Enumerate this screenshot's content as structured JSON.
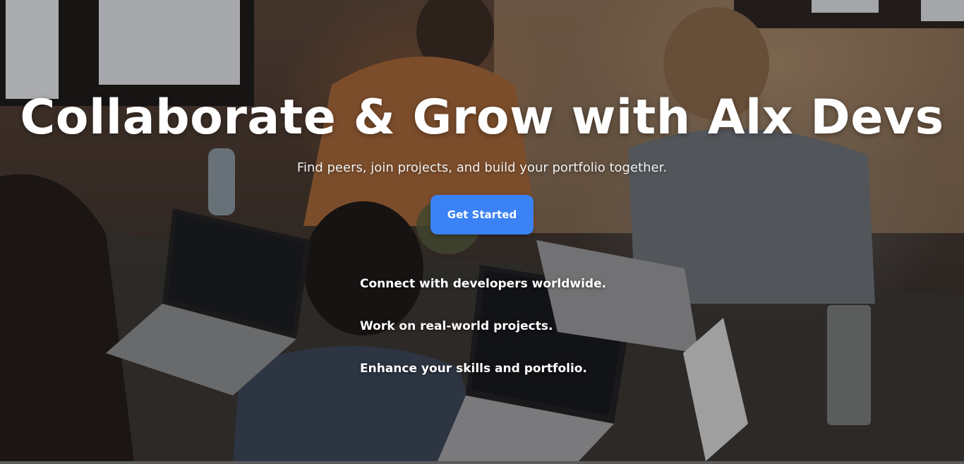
{
  "hero": {
    "background_image": "team-of-developers-working-on-laptops",
    "title": "Collaborate & Grow with Alx Devs",
    "subtitle": "Find peers, join projects, and build your portfolio together.",
    "cta_label": "Get Started",
    "features": [
      "Connect with developers worldwide.",
      "Work on real-world projects.",
      "Enhance your skills and portfolio."
    ]
  },
  "colors": {
    "accent": "#3b82f6",
    "text": "#ffffff"
  }
}
